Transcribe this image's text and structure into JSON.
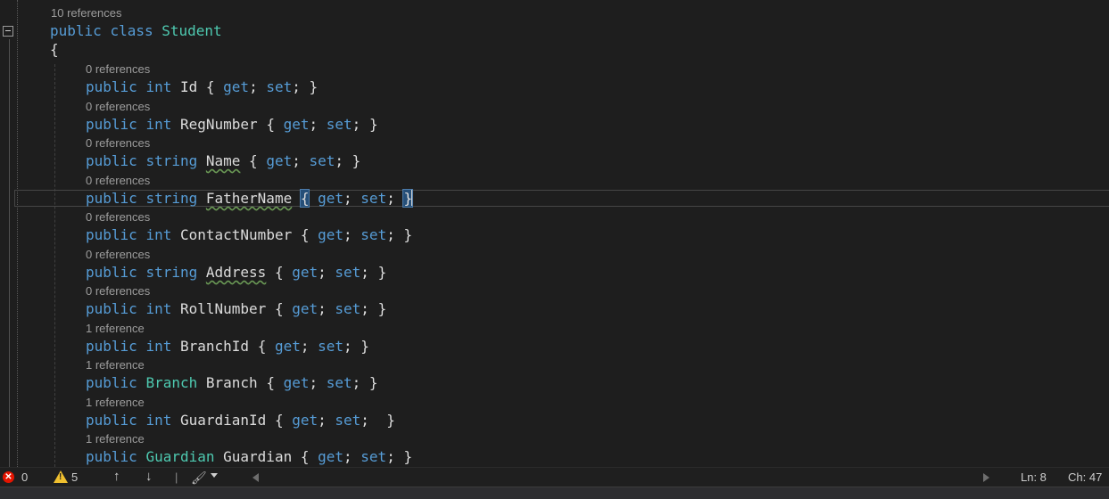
{
  "editor": {
    "class_lens": "10 references",
    "class_decl": {
      "kw1": "public",
      "kw2": "class",
      "name": "Student"
    },
    "open_brace": "{",
    "members": [
      {
        "lens": "0 references",
        "type": "int",
        "type_kind": "keyword",
        "name": "Id",
        "accessors": "{ get; set; }",
        "squiggle": false
      },
      {
        "lens": "0 references",
        "type": "int",
        "type_kind": "keyword",
        "name": "RegNumber",
        "accessors": "{ get; set; }",
        "squiggle": false
      },
      {
        "lens": "0 references",
        "type": "string",
        "type_kind": "keyword",
        "name": "Name",
        "accessors": "{ get; set; }",
        "squiggle": true
      },
      {
        "lens": "0 references",
        "type": "string",
        "type_kind": "keyword",
        "name": "FatherName",
        "accessors": "{ get; set; }",
        "squiggle": true,
        "current": true
      },
      {
        "lens": "0 references",
        "type": "int",
        "type_kind": "keyword",
        "name": "ContactNumber",
        "accessors": "{ get; set; }",
        "squiggle": false
      },
      {
        "lens": "0 references",
        "type": "string",
        "type_kind": "keyword",
        "name": "Address",
        "accessors": "{ get; set; }",
        "squiggle": true
      },
      {
        "lens": "0 references",
        "type": "int",
        "type_kind": "keyword",
        "name": "RollNumber",
        "accessors": "{ get; set; }",
        "squiggle": false
      },
      {
        "lens": "1 reference",
        "type": "int",
        "type_kind": "keyword",
        "name": "BranchId",
        "accessors": "{ get; set; }",
        "squiggle": false
      },
      {
        "lens": "1 reference",
        "type": "Branch",
        "type_kind": "class",
        "name": "Branch",
        "accessors": "{ get; set; }",
        "squiggle": false
      },
      {
        "lens": "1 reference",
        "type": "int",
        "type_kind": "keyword",
        "name": "GuardianId",
        "accessors": "{ get; set;  }",
        "squiggle": false
      },
      {
        "lens": "1 reference",
        "type": "Guardian",
        "type_kind": "class",
        "name": "Guardian",
        "accessors": "{ get; set; }",
        "squiggle": false
      }
    ],
    "member_access": "public",
    "accessor_get": "get",
    "accessor_set": "set"
  },
  "status_bar": {
    "errors": "0",
    "warnings": "5",
    "line": "Ln: 8",
    "char": "Ch: 47"
  },
  "colors": {
    "background": "#1e1e1e",
    "keyword": "#569cd6",
    "type": "#4ec9b0",
    "identifier": "#dcdcdc",
    "codelens": "#9d9d9d"
  }
}
